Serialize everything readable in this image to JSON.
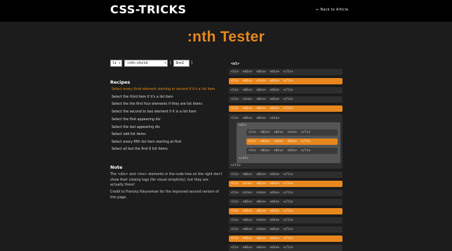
{
  "header": {
    "logo": "CSS-TRICKS",
    "back_link": "← Back to Article"
  },
  "title": ":nth Tester",
  "controls": {
    "element_select": "li",
    "pseudo_select": ":nth-child",
    "open_paren": "(",
    "formula": "3n+2",
    "close_paren": ")"
  },
  "recipes": {
    "heading": "Recipes",
    "items": [
      "Select every third element starting at second if it's a list item",
      "Select the third item if it's a list item",
      "Select the the first four elements if they are list items",
      "Select the second to last element if it is a list item",
      "Select the first appearing div",
      "Select the last appearing div",
      "Select odd list items",
      "Select every fifth list item starting at first",
      "Select all but the first 6 list items"
    ]
  },
  "note": {
    "heading": "Note",
    "paragraph1": "The <div> and <ins> elements in the code tree on the right don't show their closing tags (for visual simplicity), but they are actually there!",
    "paragraph2": "Credit to Francky Kleyneman for the improved second version of this page."
  },
  "code": {
    "ul_open": "<ul>",
    "rows_top": [
      {
        "text": "<li>  <div>  <div>  <div>  </li>",
        "hi": false
      },
      {
        "text": "<li>  <div>  <ins>  <div>  </li>",
        "hi": true
      },
      {
        "text": "<li>  <div>  <div>  <div>  </li>",
        "hi": false
      },
      {
        "text": "<li>  <ins>  <div>  <div>  </li>",
        "hi": false
      },
      {
        "text": "<li>  <div>  <div>  <div>  </li>",
        "hi": true
      }
    ],
    "nested_open": "<li>  <div>  <div>  <ins>",
    "nested_ul_open": "<ul>",
    "nested_rows": [
      {
        "text": "<li>  <div>  <div>  <ins>  </li>",
        "hi": false
      },
      {
        "text": "<li>  <div>  <ins>  <div>  </li>",
        "hi": true
      },
      {
        "text": "<li>  <div>  <div>  <div>  </li>",
        "hi": false
      }
    ],
    "nested_ul_close": "</ul>",
    "nested_close": "</li>",
    "rows_bottom": [
      {
        "text": "<li>  <div>  <div>  <div>  </li>",
        "hi": false
      },
      {
        "text": "<li>  <ins>  <div>  <div>  </li>",
        "hi": true
      },
      {
        "text": "<li>  <ins>  <ins>  <div>  </li>",
        "hi": false
      },
      {
        "text": "<li>  <div>  <div>  <div>  </li>",
        "hi": false
      },
      {
        "text": "<li>  <div>  <div>  <div>  </li>",
        "hi": true
      },
      {
        "text": "<li>  <div>  <ins>  <div>  </li>",
        "hi": false
      },
      {
        "text": "<li>  <div>  <ins>  <div>  </li>",
        "hi": false
      },
      {
        "text": "<li>  <div>  <div>  <div>  </li>",
        "hi": true
      },
      {
        "text": "<li>  <div>  <div>  <div>  </li>",
        "hi": false
      }
    ]
  },
  "colors": {
    "accent": "#e8871e",
    "background": "#1c1c1c",
    "topbar": "#000000"
  }
}
